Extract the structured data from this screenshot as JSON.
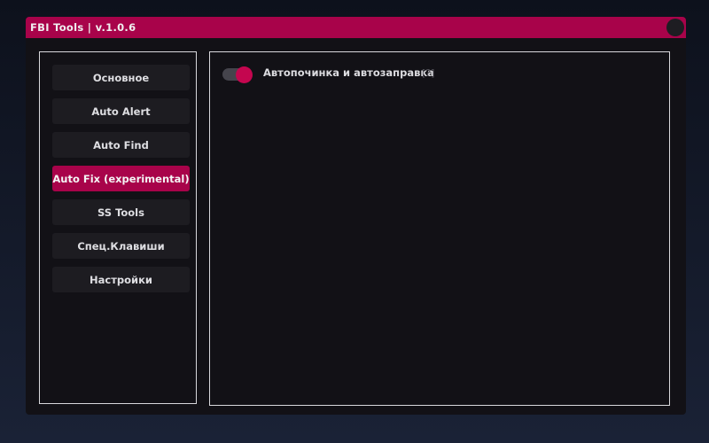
{
  "window": {
    "title": "FBI Tools | v.1.0.6",
    "accent_color": "#a8034a"
  },
  "sidebar": {
    "items": [
      {
        "label": "Основное",
        "active": false
      },
      {
        "label": "Auto Alert",
        "active": false
      },
      {
        "label": "Auto Find",
        "active": false
      },
      {
        "label": "Auto Fix (experimental)",
        "active": true
      },
      {
        "label": "SS Tools",
        "active": false
      },
      {
        "label": "Спец.Клавиши",
        "active": false
      },
      {
        "label": "Настройки",
        "active": false
      }
    ]
  },
  "content": {
    "option": {
      "label": "Автопочинка и автозаправка",
      "enabled": true,
      "help": "[?]"
    }
  }
}
